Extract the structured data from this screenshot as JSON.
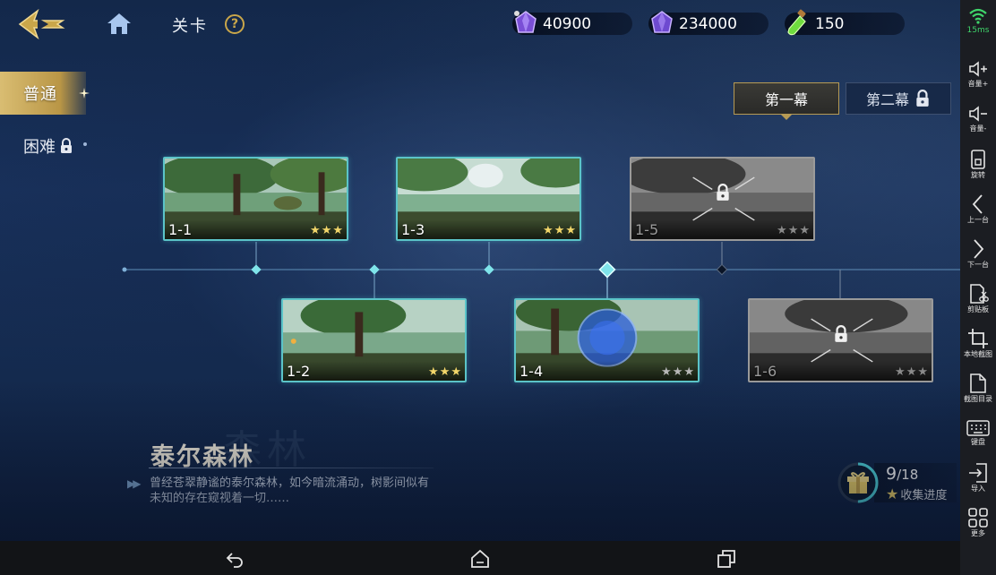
{
  "header": {
    "title": "关卡",
    "help_label": "?"
  },
  "resources": [
    {
      "icon": "crystal-icon",
      "value": "40900"
    },
    {
      "icon": "crystal-icon",
      "value": "234000"
    },
    {
      "icon": "potion-icon",
      "value": "150"
    }
  ],
  "difficulty": {
    "normal": "普通",
    "hard": "困难"
  },
  "acts": {
    "act1": "第一幕",
    "act2": "第二幕"
  },
  "stages": [
    {
      "id": "1-1",
      "stars": 3,
      "locked": false
    },
    {
      "id": "1-2",
      "stars": 3,
      "locked": false
    },
    {
      "id": "1-3",
      "stars": 3,
      "locked": false
    },
    {
      "id": "1-4",
      "stars": 0,
      "locked": false
    },
    {
      "id": "1-5",
      "stars": 0,
      "locked": true
    },
    {
      "id": "1-6",
      "stars": 0,
      "locked": true
    }
  ],
  "region": {
    "watermark": "森林",
    "title": "泰尔森林",
    "description": "曾经苍翠静谧的泰尔森林，如今暗流涌动，树影间似有未知的存在窥视着一切……"
  },
  "collection": {
    "current": "9",
    "total": "/18",
    "label": "收集进度",
    "progress": 0.5
  },
  "sidebar": {
    "wifi_latency": "15ms",
    "items": [
      "音量+",
      "音量-",
      "旋转",
      "上一台",
      "下一台",
      "剪贴板",
      "本地截图",
      "截图目录",
      "键盘",
      "导入",
      "更多"
    ]
  },
  "colors": {
    "accent_gold": "#c9a64a",
    "stage_border": "#5bc4c8",
    "star": "#f2d66a",
    "wifi": "#3fd46a"
  }
}
